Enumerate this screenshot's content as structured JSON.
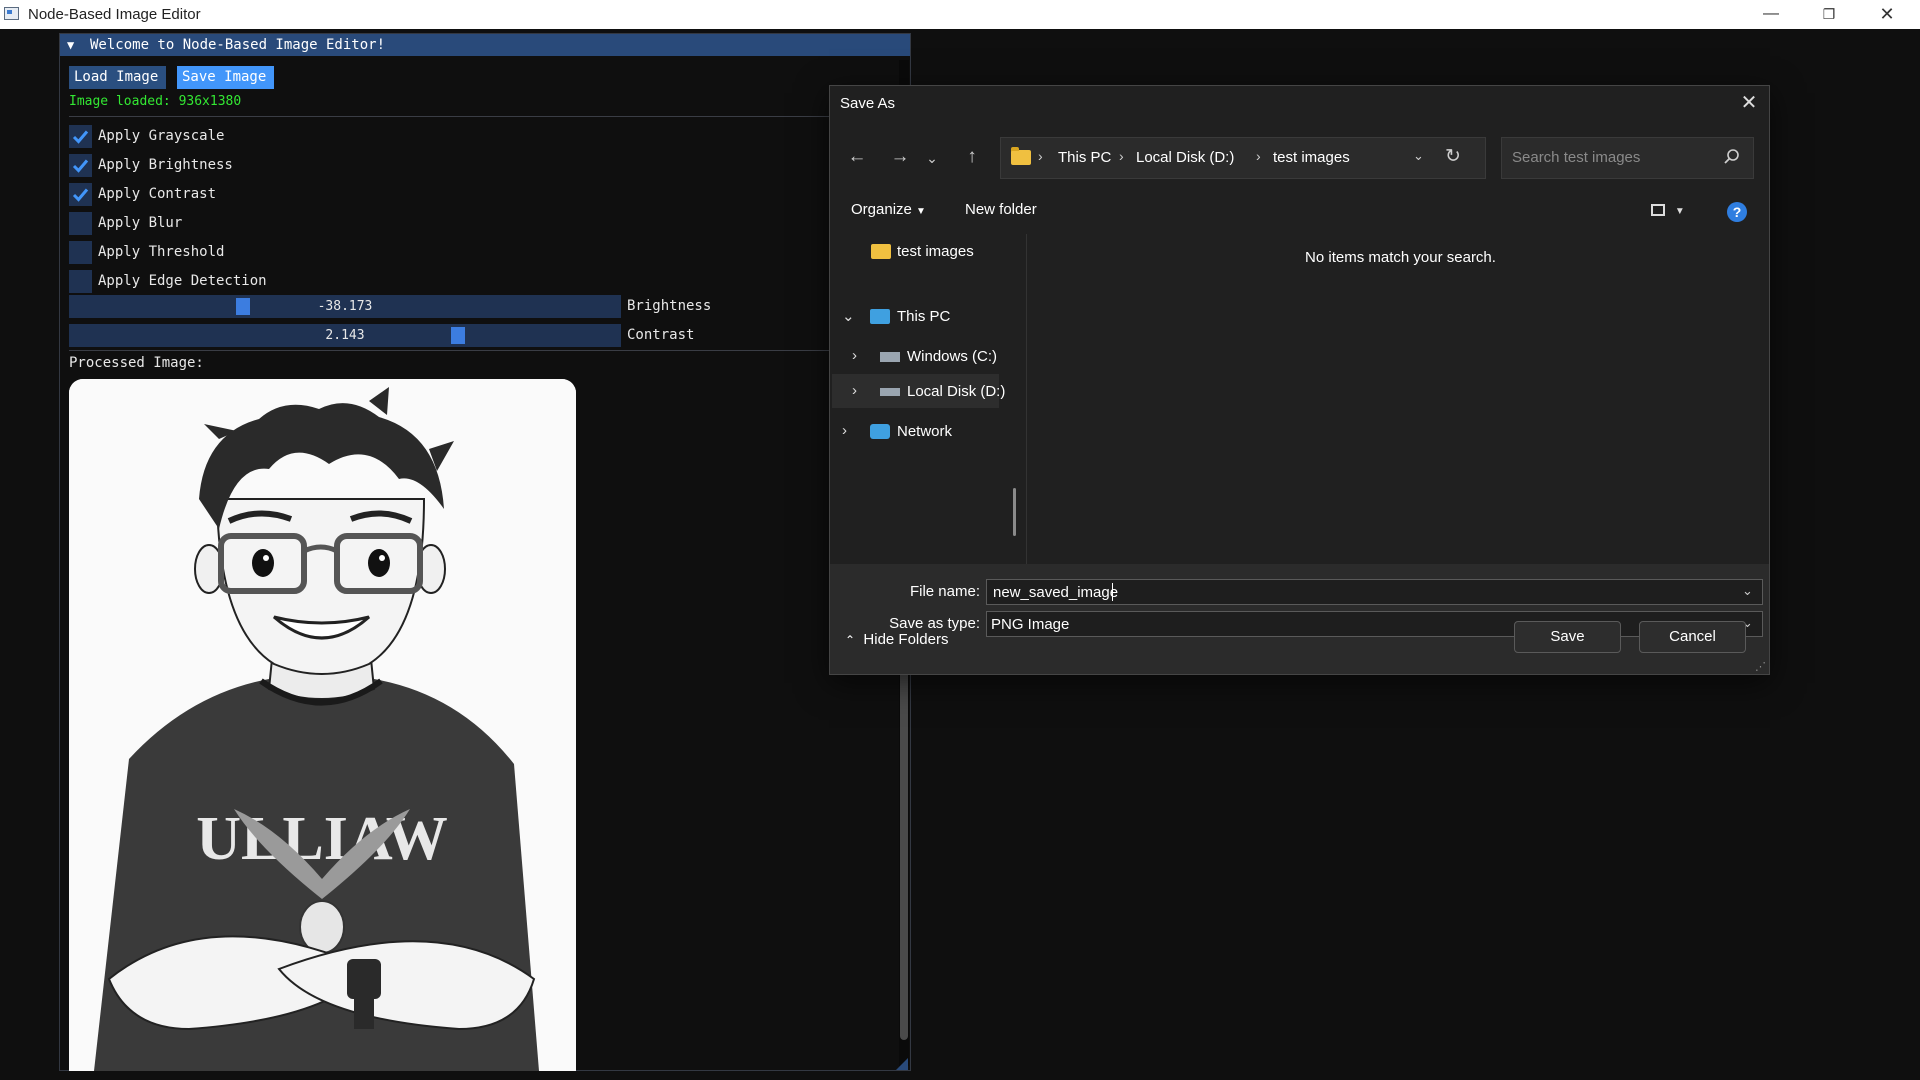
{
  "window": {
    "title": "Node-Based Image Editor"
  },
  "imgui": {
    "title": "Welcome to Node-Based Image Editor!",
    "load_button": "Load Image",
    "save_button": "Save Image",
    "status": "Image loaded: 936x1380",
    "checkboxes": [
      {
        "label": "Apply Grayscale",
        "checked": true
      },
      {
        "label": "Apply Brightness",
        "checked": true
      },
      {
        "label": "Apply Contrast",
        "checked": true
      },
      {
        "label": "Apply Blur",
        "checked": false
      },
      {
        "label": "Apply Threshold",
        "checked": false
      },
      {
        "label": "Apply Edge Detection",
        "checked": false
      }
    ],
    "sliders": [
      {
        "label": "Brightness",
        "value_text": "-38.173",
        "fraction": 0.31
      },
      {
        "label": "Contrast",
        "value_text": "2.143",
        "fraction": 0.71
      }
    ],
    "processed_label": "Processed Image:",
    "preview_text": "ULLIAW"
  },
  "dialog": {
    "title": "Save As",
    "breadcrumb": [
      "This PC",
      "Local Disk (D:)",
      "test images"
    ],
    "search_placeholder": "Search test images",
    "organize": "Organize",
    "new_folder": "New folder",
    "tree": {
      "pinned": "test images",
      "this_pc": "This PC",
      "windows": "Windows (C:)",
      "local_disk": "Local Disk (D:)",
      "network": "Network"
    },
    "empty_message": "No items match your search.",
    "file_name_label": "File name:",
    "file_name_value": "new_saved_image",
    "save_type_label": "Save as type:",
    "save_type_value": "PNG Image",
    "hide_folders": "Hide Folders",
    "save": "Save",
    "cancel": "Cancel"
  },
  "colors": {
    "accent": "#4296fa",
    "status_green": "#33e833",
    "header": "#294a7a",
    "help": "#2f7ee0"
  }
}
